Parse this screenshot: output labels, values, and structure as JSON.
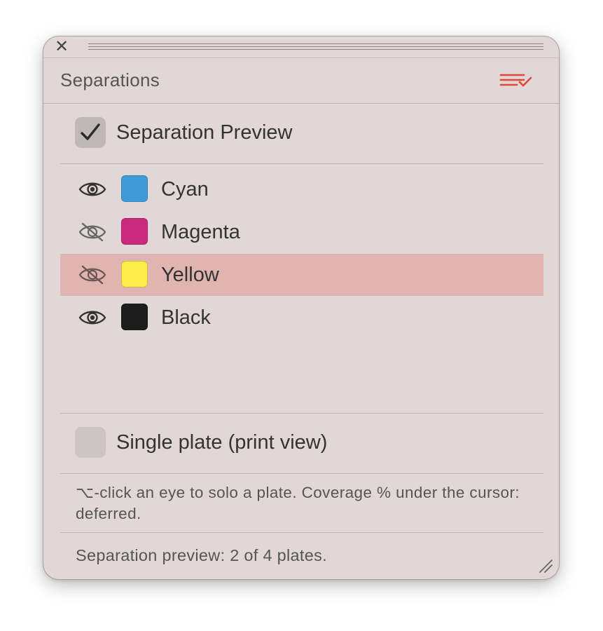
{
  "window": {
    "close_glyph": "✕"
  },
  "panel": {
    "title": "Separations",
    "menu_icon": "list-check-icon",
    "accent_color": "#e0483a"
  },
  "separation_preview": {
    "label": "Separation Preview",
    "checked": true
  },
  "plates": [
    {
      "name": "Cyan",
      "color": "#3f9bd8",
      "visible": true,
      "selected": false
    },
    {
      "name": "Magenta",
      "color": "#c92a7e",
      "visible": false,
      "selected": false
    },
    {
      "name": "Yellow",
      "color": "#fbec47",
      "visible": false,
      "selected": true
    },
    {
      "name": "Black",
      "color": "#1c1c1c",
      "visible": true,
      "selected": false
    }
  ],
  "single_plate": {
    "label": "Single plate (print view)",
    "checked": false
  },
  "hint": {
    "text": "⌥-click an eye to solo a plate. Coverage % under the cursor: deferred."
  },
  "status": {
    "text": "Separation preview: 2 of 4 plates."
  }
}
